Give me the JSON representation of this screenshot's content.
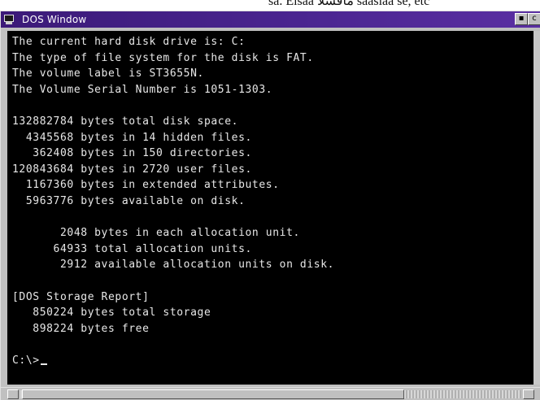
{
  "caption": {
    "text": "sa. Eisaa ماقشلا saasiaa se, etc"
  },
  "window": {
    "title": "DOS Window",
    "icon": "dos-window-icon",
    "titlebar_color": "#3b1a78",
    "controls": {
      "minimize_glyph": "▪",
      "close_glyph": "c"
    }
  },
  "console": {
    "background": "#000000",
    "foreground": "#e8e8e8",
    "lines": [
      "The current hard disk drive is: C:",
      "The type of file system for the disk is FAT.",
      "The volume label is ST3655N.",
      "The Volume Serial Number is 1051-1303.",
      "",
      "132882784 bytes total disk space.",
      "  4345568 bytes in 14 hidden files.",
      "   362408 bytes in 150 directories.",
      "120843684 bytes in 2720 user files.",
      "  1167360 bytes in extended attributes.",
      "  5963776 bytes available on disk.",
      "",
      "       2048 bytes in each allocation unit.",
      "      64933 total allocation units.",
      "       2912 available allocation units on disk.",
      "",
      "[DOS Storage Report]",
      "   850224 bytes total storage",
      "   898224 bytes free",
      "",
      ""
    ],
    "prompt": "C:\\>"
  }
}
